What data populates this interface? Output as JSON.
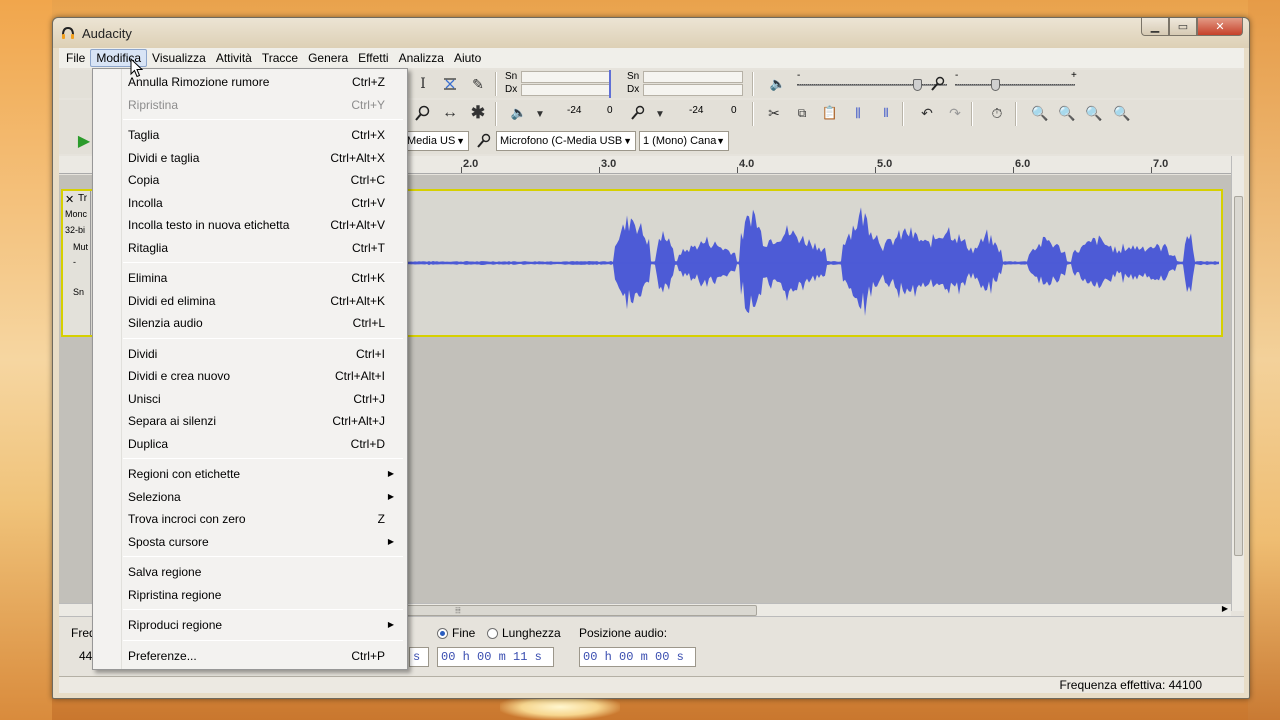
{
  "window": {
    "title": "Audacity"
  },
  "menubar": [
    "File",
    "Modifica",
    "Visualizza",
    "Attività",
    "Tracce",
    "Genera",
    "Effetti",
    "Analizza",
    "Aiuto"
  ],
  "active_menu": "Modifica",
  "dropdown": {
    "groups": [
      [
        {
          "label": "Annulla Rimozione rumore",
          "shortcut": "Ctrl+Z"
        },
        {
          "label": "Ripristina",
          "shortcut": "Ctrl+Y",
          "disabled": true
        }
      ],
      [
        {
          "label": "Taglia",
          "shortcut": "Ctrl+X"
        },
        {
          "label": "Dividi e taglia",
          "shortcut": "Ctrl+Alt+X"
        },
        {
          "label": "Copia",
          "shortcut": "Ctrl+C"
        },
        {
          "label": "Incolla",
          "shortcut": "Ctrl+V"
        },
        {
          "label": "Incolla testo in nuova etichetta",
          "shortcut": "Ctrl+Alt+V"
        },
        {
          "label": "Ritaglia",
          "shortcut": "Ctrl+T"
        }
      ],
      [
        {
          "label": "Elimina",
          "shortcut": "Ctrl+K"
        },
        {
          "label": "Dividi ed elimina",
          "shortcut": "Ctrl+Alt+K"
        },
        {
          "label": "Silenzia audio",
          "shortcut": "Ctrl+L"
        }
      ],
      [
        {
          "label": "Dividi",
          "shortcut": "Ctrl+I"
        },
        {
          "label": "Dividi e crea nuovo",
          "shortcut": "Ctrl+Alt+I"
        },
        {
          "label": "Unisci",
          "shortcut": "Ctrl+J"
        },
        {
          "label": "Separa ai silenzi",
          "shortcut": "Ctrl+Alt+J"
        },
        {
          "label": "Duplica",
          "shortcut": "Ctrl+D"
        }
      ],
      [
        {
          "label": "Regioni con etichette",
          "submenu": true
        },
        {
          "label": "Seleziona",
          "submenu": true
        },
        {
          "label": "Trova incroci con zero",
          "shortcut": "Z"
        },
        {
          "label": "Sposta cursore",
          "submenu": true
        }
      ],
      [
        {
          "label": "Salva regione"
        },
        {
          "label": "Ripristina regione"
        }
      ],
      [
        {
          "label": "Riproduci regione",
          "submenu": true
        }
      ],
      [
        {
          "label": "Preferenze...",
          "shortcut": "Ctrl+P"
        }
      ]
    ]
  },
  "meters": {
    "rec_left": "Sn",
    "rec_right": "Dx",
    "play_left": "Sn",
    "play_right": "Dx",
    "scale_a": [
      "-24",
      "0"
    ],
    "scale_b": [
      "-24",
      "0"
    ]
  },
  "device": {
    "output": "Media US",
    "input": "Microfono (C-Media USB",
    "channels": "1 (Mono) Cana"
  },
  "ruler": [
    "2.0",
    "3.0",
    "4.0",
    "5.0",
    "6.0",
    "7.0"
  ],
  "track": {
    "name": "Tr",
    "line1": "Monc",
    "line2": "32-bi",
    "mute": "Mut",
    "minus": "-",
    "sn": "Sn"
  },
  "selection": {
    "rate_label": "Freq",
    "rate_value": "44",
    "end_label": "Fine",
    "length_label": "Lunghezza",
    "position_label": "Posizione audio:",
    "start_suffix": "s",
    "end_time": "00 h 00 m 11 s",
    "position_time": "00 h 00 m 00 s"
  },
  "status": {
    "rate": "Frequenza effettiva: 44100"
  },
  "colors": {
    "waveform": "#4d5bd6",
    "selection_border": "#d6d000",
    "menu_highlight": "#d8e4f5"
  }
}
